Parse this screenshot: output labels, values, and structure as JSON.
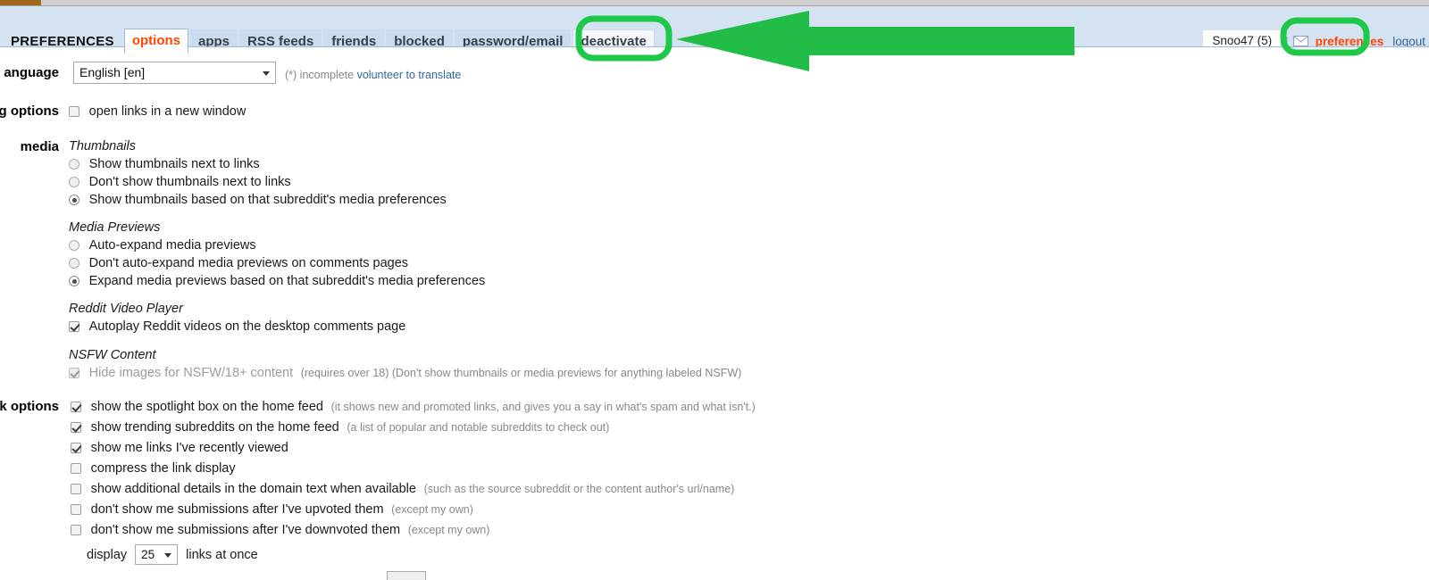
{
  "header": {
    "title": "PREFERENCES",
    "tabs": [
      {
        "label": "options",
        "selected": true
      },
      {
        "label": "apps",
        "selected": false
      },
      {
        "label": "RSS feeds",
        "selected": false
      },
      {
        "label": "friends",
        "selected": false
      },
      {
        "label": "blocked",
        "selected": false
      },
      {
        "label": "password/email",
        "selected": false
      },
      {
        "label": "deactivate",
        "selected": false,
        "highlighted": true
      }
    ]
  },
  "userbar": {
    "username": "Snoo47 (5)",
    "separator": "|",
    "mail_icon": "envelope-icon",
    "preferences_label": "preferences",
    "logout_label": "logout"
  },
  "annotations": {
    "arrow_color": "#22bb44",
    "highlight_color": "#1ec94a",
    "arrow_target": "deactivate",
    "circled_items": [
      "deactivate",
      "preferences"
    ]
  },
  "sections": {
    "language": {
      "label": "anguage",
      "full_label": "language",
      "select_value": "English [en]",
      "hint_prefix": "(*) incomplete ",
      "hint_link": "volunteer to translate"
    },
    "browsing_options": {
      "label": "g options",
      "full_label": "browsing options",
      "items": [
        {
          "text": "open links in a new window",
          "checked": false
        }
      ]
    },
    "media": {
      "label": "media",
      "groups": [
        {
          "title": "Thumbnails",
          "options": [
            {
              "text": "Show thumbnails next to links",
              "selected": false
            },
            {
              "text": "Don't show thumbnails next to links",
              "selected": false
            },
            {
              "text": "Show thumbnails based on that subreddit's media preferences",
              "selected": true
            }
          ]
        },
        {
          "title": "Media Previews",
          "options": [
            {
              "text": "Auto-expand media previews",
              "selected": false
            },
            {
              "text": "Don't auto-expand media previews on comments pages",
              "selected": false
            },
            {
              "text": "Expand media previews based on that subreddit's media preferences",
              "selected": true
            }
          ]
        }
      ],
      "video_group": {
        "title": "Reddit Video Player",
        "text": "Autoplay Reddit videos on the desktop comments page",
        "checked": true
      },
      "nsfw_group": {
        "title": "NSFW Content",
        "text": "Hide images for NSFW/18+ content",
        "hint": "(requires over 18) (Don't show thumbnails or media previews for anything labeled NSFW)",
        "checked": true,
        "disabled": true
      }
    },
    "link_options": {
      "label": "k options",
      "full_label": "link options",
      "items": [
        {
          "text": "show the spotlight box on the home feed",
          "hint": "(it shows new and promoted links, and gives you a say in what's spam and what isn't.)",
          "checked": true
        },
        {
          "text": "show trending subreddits on the home feed",
          "hint": "(a list of popular and notable subreddits to check out)",
          "checked": true
        },
        {
          "text": "show me links I've recently viewed",
          "hint": "",
          "checked": true
        },
        {
          "text": "compress the link display",
          "hint": "",
          "checked": false
        },
        {
          "text": "show additional details in the domain text when available",
          "hint": "(such as the source subreddit or the content author's url/name)",
          "checked": false
        },
        {
          "text": "don't show me submissions after I've upvoted them",
          "hint": "(except my own)",
          "checked": false
        },
        {
          "text": "don't show me submissions after I've downvoted them",
          "hint": "(except my own)",
          "checked": false
        }
      ],
      "display_row": {
        "prefix": "display",
        "value": "25",
        "suffix": "links at once"
      }
    }
  }
}
